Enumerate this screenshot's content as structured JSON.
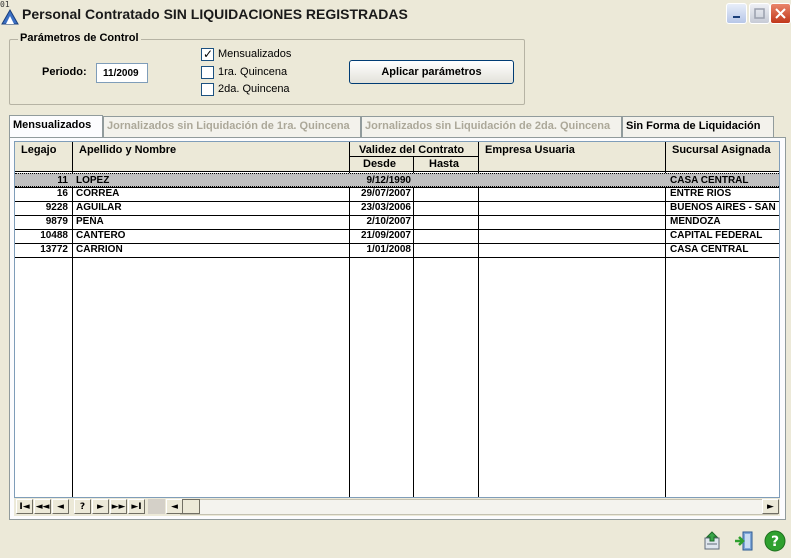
{
  "window": {
    "tiny_label": "01",
    "title": "Personal Contratado SIN LIQUIDACIONES REGISTRADAS",
    "buttons": [
      "minimize",
      "maximize",
      "close"
    ]
  },
  "parametros": {
    "legend": "Parámetros de Control",
    "periodo_label": "Periodo:",
    "periodo_value": "11/2009",
    "checks": [
      {
        "label": "Mensualizados",
        "checked": true
      },
      {
        "label": "1ra. Quincena",
        "checked": false
      },
      {
        "label": "2da. Quincena",
        "checked": false
      }
    ],
    "apply_label": "Aplicar parámetros"
  },
  "tabs": [
    {
      "label": "Mensualizados",
      "state": "active"
    },
    {
      "label": "Jornalizados sin Liquidación de 1ra. Quincena",
      "state": "disabled"
    },
    {
      "label": "Jornalizados sin Liquidación de 2da. Quincena",
      "state": "disabled"
    },
    {
      "label": "Sin Forma de Liquidación",
      "state": "enabled"
    }
  ],
  "table": {
    "columns": {
      "legajo": "Legajo",
      "apellido": "Apellido y Nombre",
      "validez": "Validez del Contrato",
      "desde": "Desde",
      "hasta": "Hasta",
      "empresa": "Empresa Usuaria",
      "sucursal": "Sucursal Asignada"
    },
    "rows": [
      {
        "legajo": "11",
        "apellido": "LOPEZ",
        "desde": "9/12/1990",
        "hasta": "",
        "empresa": "",
        "sucursal": "CASA CENTRAL",
        "selected": true
      },
      {
        "legajo": "16",
        "apellido": "CORREA",
        "desde": "29/07/2007",
        "hasta": "",
        "empresa": "",
        "sucursal": "ENTRE RIOS",
        "selected": false
      },
      {
        "legajo": "9228",
        "apellido": "AGUILAR",
        "desde": "23/03/2006",
        "hasta": "",
        "empresa": "",
        "sucursal": "BUENOS AIRES - SAN",
        "selected": false
      },
      {
        "legajo": "9879",
        "apellido": "PEÑA",
        "desde": "2/10/2007",
        "hasta": "",
        "empresa": "",
        "sucursal": "MENDOZA",
        "selected": false
      },
      {
        "legajo": "10488",
        "apellido": "CANTERO",
        "desde": "21/09/2007",
        "hasta": "",
        "empresa": "",
        "sucursal": "CAPITAL FEDERAL",
        "selected": false
      },
      {
        "legajo": "13772",
        "apellido": "CARRION",
        "desde": "1/01/2008",
        "hasta": "",
        "empresa": "",
        "sucursal": "CASA CENTRAL",
        "selected": false
      }
    ]
  },
  "navigator": {
    "buttons": [
      "I◄",
      "◄◄",
      "◄",
      "?",
      "►",
      "►►",
      "►I"
    ],
    "scroll_left": "◄",
    "scroll_right": "►"
  },
  "footer_icons": [
    "refresh-icon",
    "exit-icon",
    "help-icon"
  ],
  "colors": {
    "background": "#ece9d8",
    "selected_row": "#c0c0c0",
    "close_button": "#c1381b",
    "help_icon": "#2ea02e"
  }
}
